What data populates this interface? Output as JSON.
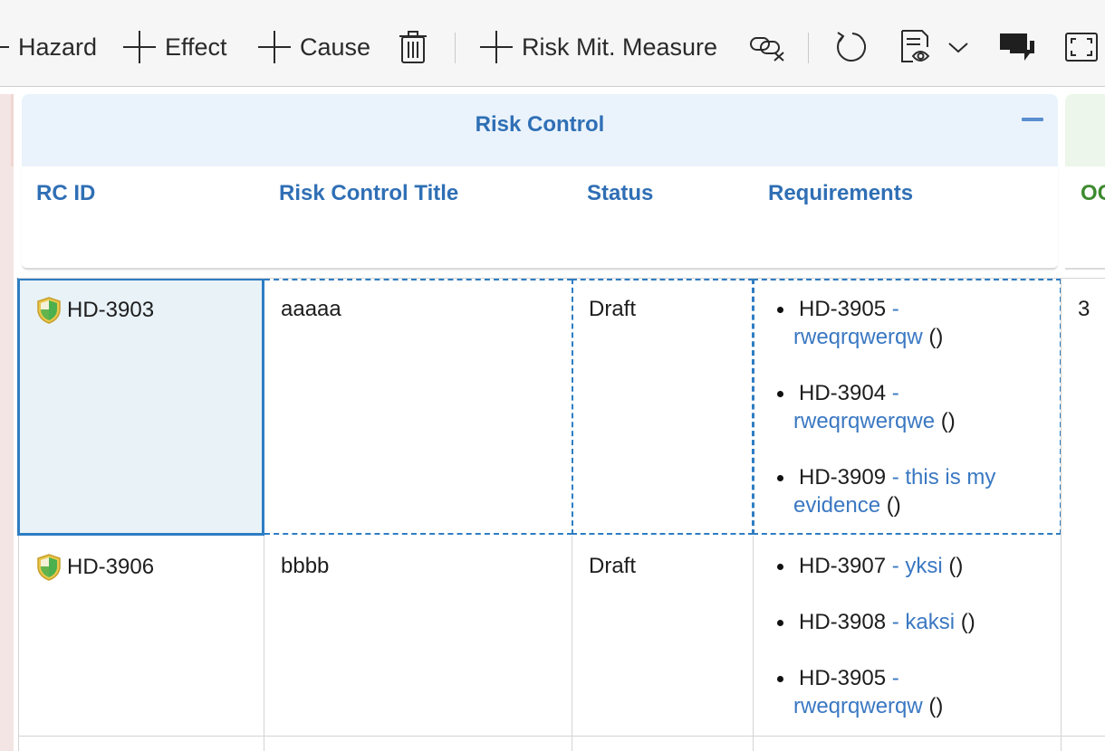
{
  "toolbar": {
    "hazard_label": "Hazard",
    "effect_label": "Effect",
    "cause_label": "Cause",
    "risk_mit_label": "Risk Mit. Measure"
  },
  "group": {
    "title": "Risk Control",
    "columns": [
      "RC ID",
      "Risk Control Title",
      "Status",
      "Requirements"
    ],
    "next_column_partial": "OC"
  },
  "rows": [
    {
      "rc_id": "HD-3903",
      "title": "aaaaa",
      "status": "Draft",
      "requirements": [
        {
          "id": "HD-3905",
          "title_line1": " -",
          "title_line2": "rweqrqwerqw",
          "paren": " ()"
        },
        {
          "id": "HD-3904",
          "title_line1": " -",
          "title_line2": "rweqrqwerqwe",
          "paren": " ()"
        },
        {
          "id": "HD-3909",
          "title_line1": " - this is my",
          "title_line2": "evidence",
          "paren": " ()"
        }
      ],
      "next_value": "3"
    },
    {
      "rc_id": "HD-3906",
      "title": "bbbb",
      "status": "Draft",
      "requirements": [
        {
          "id": "HD-3907",
          "title_line1": " - yksi",
          "title_line2": "",
          "paren": " ()"
        },
        {
          "id": "HD-3908",
          "title_line1": " - kaksi",
          "title_line2": "",
          "paren": " ()"
        },
        {
          "id": "HD-3905",
          "title_line1": " -",
          "title_line2": "rweqrqwerqw",
          "paren": " ()"
        }
      ],
      "next_value": ""
    }
  ]
}
